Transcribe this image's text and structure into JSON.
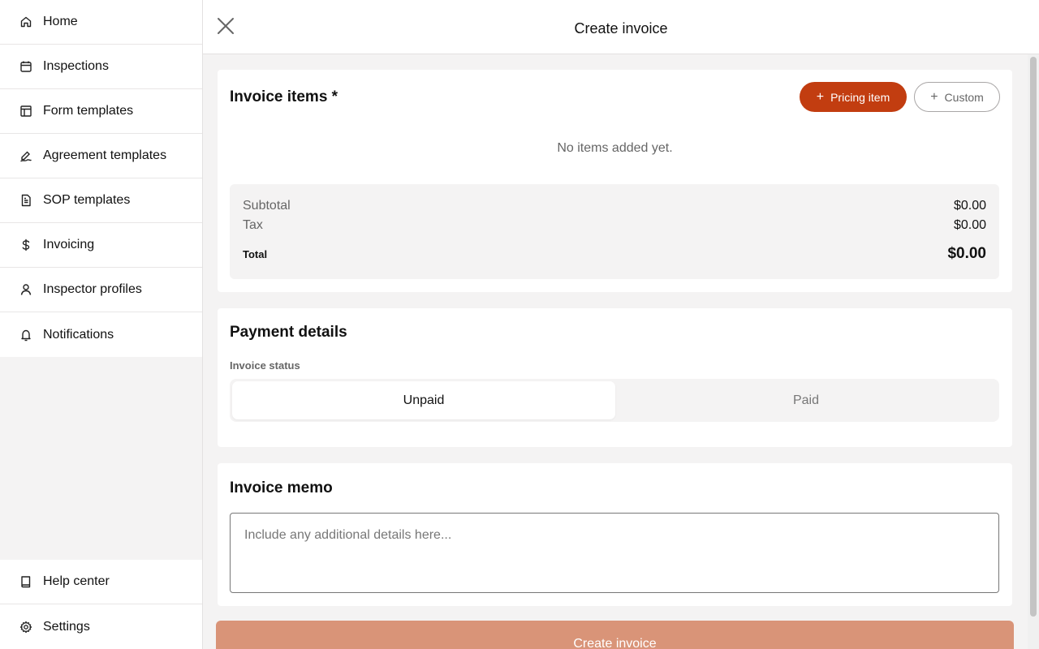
{
  "sidebar": {
    "items": [
      {
        "label": "Home",
        "icon": "home-icon"
      },
      {
        "label": "Inspections",
        "icon": "calendar-icon"
      },
      {
        "label": "Form templates",
        "icon": "layout-icon"
      },
      {
        "label": "Agreement templates",
        "icon": "signature-icon"
      },
      {
        "label": "SOP templates",
        "icon": "document-icon"
      },
      {
        "label": "Invoicing",
        "icon": "dollar-icon"
      },
      {
        "label": "Inspector profiles",
        "icon": "user-icon"
      },
      {
        "label": "Notifications",
        "icon": "bell-icon"
      }
    ],
    "bottom_items": [
      {
        "label": "Help center",
        "icon": "book-icon"
      },
      {
        "label": "Settings",
        "icon": "gear-icon"
      }
    ]
  },
  "header": {
    "title": "Create invoice"
  },
  "invoice_items": {
    "title": "Invoice items *",
    "pricing_button": "Pricing item",
    "custom_button": "Custom",
    "empty_text": "No items added yet.",
    "subtotal_label": "Subtotal",
    "subtotal_value": "$0.00",
    "tax_label": "Tax",
    "tax_value": "$0.00",
    "total_label": "Total",
    "total_value": "$0.00"
  },
  "payment": {
    "title": "Payment details",
    "status_label": "Invoice status",
    "options": [
      "Unpaid",
      "Paid"
    ],
    "selected": "Unpaid"
  },
  "memo": {
    "title": "Invoice memo",
    "placeholder": "Include any additional details here...",
    "value": ""
  },
  "submit": {
    "label": "Create invoice"
  },
  "colors": {
    "accent": "#c23d10",
    "submit_disabled": "#d99478",
    "background": "#f4f3f3"
  }
}
